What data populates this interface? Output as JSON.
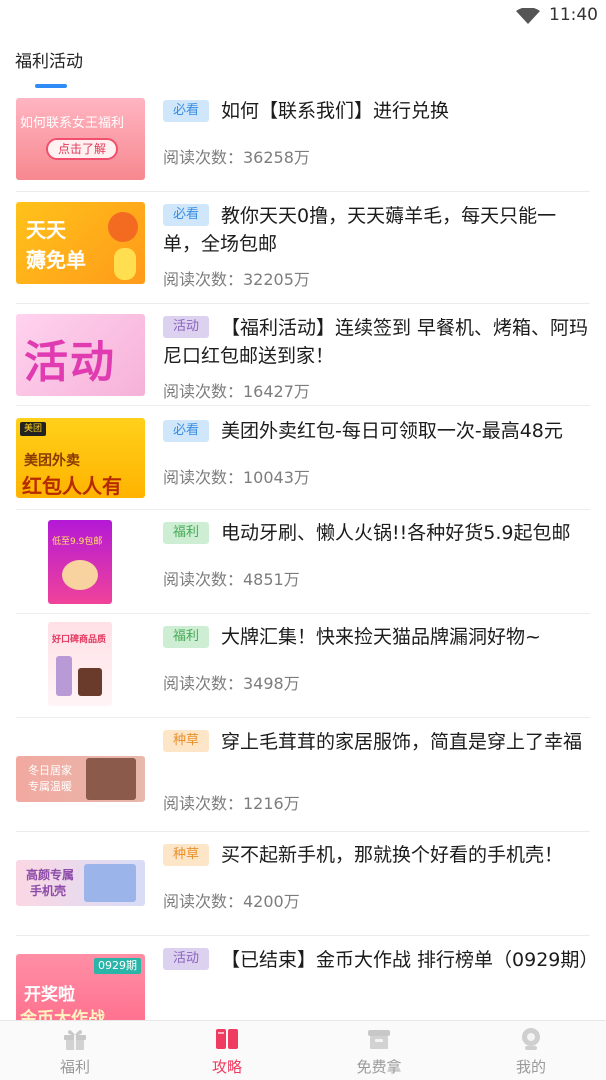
{
  "status": {
    "time": "11:40"
  },
  "tab": {
    "label": "福利活动"
  },
  "items": [
    {
      "tag": "必看",
      "tag_color": "blue",
      "title": "如何【联系我们】进行兑换",
      "reads": "阅读次数：36258万",
      "thumb_text_1": "如何联系女王福利",
      "thumb_text_2": "点击了解"
    },
    {
      "tag": "必看",
      "tag_color": "blue",
      "title": "教你天天0撸，天天薅羊毛，每天只能一单，全场包邮",
      "reads": "阅读次数：32205万",
      "thumb_text_1": "天天",
      "thumb_text_2": "薅免单"
    },
    {
      "tag": "活动",
      "tag_color": "purple",
      "title": "【福利活动】连续签到 早餐机、烤箱、阿玛尼口红包邮送到家！",
      "reads": "阅读次数：16427万",
      "thumb_text_1": "活动"
    },
    {
      "tag": "必看",
      "tag_color": "blue",
      "title": "美团外卖红包-每日可领取一次-最高48元",
      "reads": "阅读次数：10043万",
      "thumb_text_1": "美团",
      "thumb_text_2": "美团外卖",
      "thumb_text_3": "红包人人有"
    },
    {
      "tag": "福利",
      "tag_color": "green",
      "title": "电动牙刷、懒人火锅!!各种好货5.9起包邮",
      "reads": "阅读次数：4851万",
      "thumb_text_1": "低至9.9包邮"
    },
    {
      "tag": "福利",
      "tag_color": "green",
      "title": "大牌汇集！快来捡天猫品牌漏洞好物~",
      "reads": "阅读次数：3498万",
      "thumb_text_1": "好口碑商品质"
    },
    {
      "tag": "种草",
      "tag_color": "orange",
      "title": "穿上毛茸茸的家居服饰，简直是穿上了幸福",
      "reads": "阅读次数：1216万",
      "thumb_text_1": "冬日居家",
      "thumb_text_2": "专属温暖"
    },
    {
      "tag": "种草",
      "tag_color": "orange",
      "title": "买不起新手机，那就换个好看的手机壳！",
      "reads": "阅读次数：4200万",
      "thumb_text_1": "高颜专属",
      "thumb_text_2": "手机壳"
    },
    {
      "tag": "活动",
      "tag_color": "purple",
      "title": "【已结束】金币大作战 排行榜单（0929期）",
      "reads": "",
      "thumb_text_1": "0929期",
      "thumb_text_2": "开奖啦",
      "thumb_text_3": "金币大作战"
    }
  ],
  "nav": [
    {
      "label": "福利",
      "icon": "gift-icon",
      "active": false
    },
    {
      "label": "攻略",
      "icon": "book-icon",
      "active": true
    },
    {
      "label": "免费拿",
      "icon": "box-icon",
      "active": false
    },
    {
      "label": "我的",
      "icon": "profile-icon",
      "active": false
    }
  ],
  "colors": {
    "accent": "#2f8bf5",
    "nav_active": "#ef3b5f"
  }
}
